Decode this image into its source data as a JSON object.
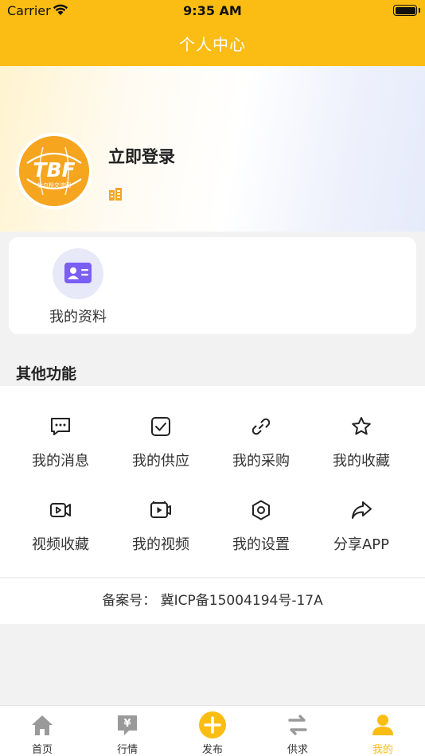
{
  "status_bar": {
    "carrier": "Carrier",
    "time": "9:35 AM"
  },
  "header": {
    "title": "个人中心"
  },
  "profile": {
    "avatar_logo_text": "TBF",
    "avatar_logo_subtitle": "钛白粉交流圈",
    "login_label": "立即登录"
  },
  "profile_card": {
    "label": "我的资料"
  },
  "other_functions": {
    "title": "其他功能",
    "items": [
      {
        "label": "我的消息",
        "icon": "message-icon"
      },
      {
        "label": "我的供应",
        "icon": "checkbox-icon"
      },
      {
        "label": "我的采购",
        "icon": "link-icon"
      },
      {
        "label": "我的收藏",
        "icon": "star-icon"
      },
      {
        "label": "视频收藏",
        "icon": "video-camera-icon"
      },
      {
        "label": "我的视频",
        "icon": "video-play-icon"
      },
      {
        "label": "我的设置",
        "icon": "settings-icon"
      },
      {
        "label": "分享APP",
        "icon": "share-icon"
      }
    ]
  },
  "icp": {
    "text": "备案号：  冀ICP备15004194号-17A"
  },
  "tabbar": {
    "items": [
      {
        "label": "首页",
        "icon": "home-icon"
      },
      {
        "label": "行情",
        "icon": "market-icon"
      },
      {
        "label": "发布",
        "icon": "publish-icon"
      },
      {
        "label": "供求",
        "icon": "exchange-icon"
      },
      {
        "label": "我的",
        "icon": "user-icon"
      }
    ],
    "active_index": 4
  },
  "colors": {
    "accent": "#fbbd14",
    "avatar": "#f6a51f",
    "profile_icon": "#7b5ef3"
  }
}
